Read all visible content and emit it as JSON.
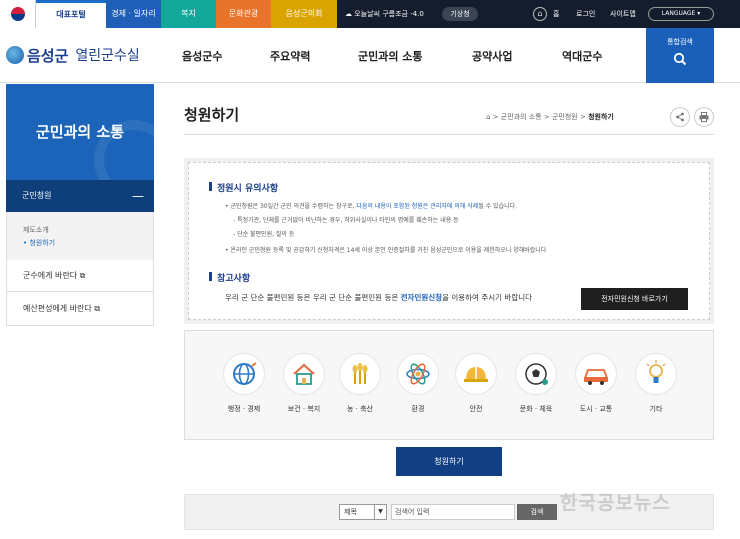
{
  "topbar": {
    "tabs": [
      "대표포털",
      "경제 · 일자리",
      "복지",
      "문화관광",
      "음성군의회"
    ],
    "weather": "오늘날씨 구름조금 -4.0",
    "weather_button": "기상청",
    "links": [
      "홈",
      "로그인",
      "사이트맵"
    ],
    "language": "LANGUAGE"
  },
  "header": {
    "logo_main": "음성군",
    "logo_sub": "열린군수실",
    "nav": [
      "음성군수",
      "주요약력",
      "군민과의 소통",
      "공약사업",
      "역대군수"
    ],
    "search_label": "통합검색",
    "search_icon": "magnifier-icon"
  },
  "sidebar": {
    "title": "군민과의 소통",
    "active": "군민청원",
    "sub_items": [
      "제도소개",
      "청원하기"
    ],
    "items": [
      "군수에게 바란다",
      "예산편성에게 바란다"
    ]
  },
  "page": {
    "title": "청원하기",
    "breadcrumb": [
      "군민과의 소통",
      "군민청원",
      "청원하기"
    ]
  },
  "notice": {
    "heading1": "정원시 유의사항",
    "line1_pre": "군민청원은 30일간 군민 의견을 수렴하는 창구로,",
    "line1_hl": "다음의 내용이 포함된 청원은 관리자에 의해 삭제",
    "line1_post": "될 수 있습니다.",
    "line2": "- 특정기관, 단체를 근거없이 비난하는 경우, 허위사실이나 타인의 명예를 훼손하는 내용 등",
    "line3": "- 단순 불편민원, 질의 등",
    "line4": "온라인 군민청원 등록 및 공감하기 신청자격은 14세 이상 본인 인증절차를 거친 음성군민으로 이용을 제한하오니 양해바랍니다",
    "heading2": "참고사항",
    "ref_pre": "우리 군 단순 불편민원 등은 우리 군 단순 불편민원 등은",
    "ref_hl": "전자민원신청",
    "ref_post": "을 이용하여 주시기 바랍니다",
    "button": "전자민원신청 바로가기"
  },
  "categories": [
    {
      "label": "행정 · 경제",
      "icon": "globe-icon"
    },
    {
      "label": "보건 · 복지",
      "icon": "house-icon"
    },
    {
      "label": "농 · 축산",
      "icon": "wheat-icon"
    },
    {
      "label": "환경",
      "icon": "atom-icon"
    },
    {
      "label": "안전",
      "icon": "helmet-icon"
    },
    {
      "label": "문화 · 체육",
      "icon": "ball-icon"
    },
    {
      "label": "도시 · 교통",
      "icon": "car-icon"
    },
    {
      "label": "기타",
      "icon": "lightbulb-icon"
    }
  ],
  "petition_button": "청원하기",
  "search": {
    "select_value": "제목",
    "placeholder": "검색어 입력",
    "button": "검색"
  },
  "watermark": "한국공보뉴스"
}
